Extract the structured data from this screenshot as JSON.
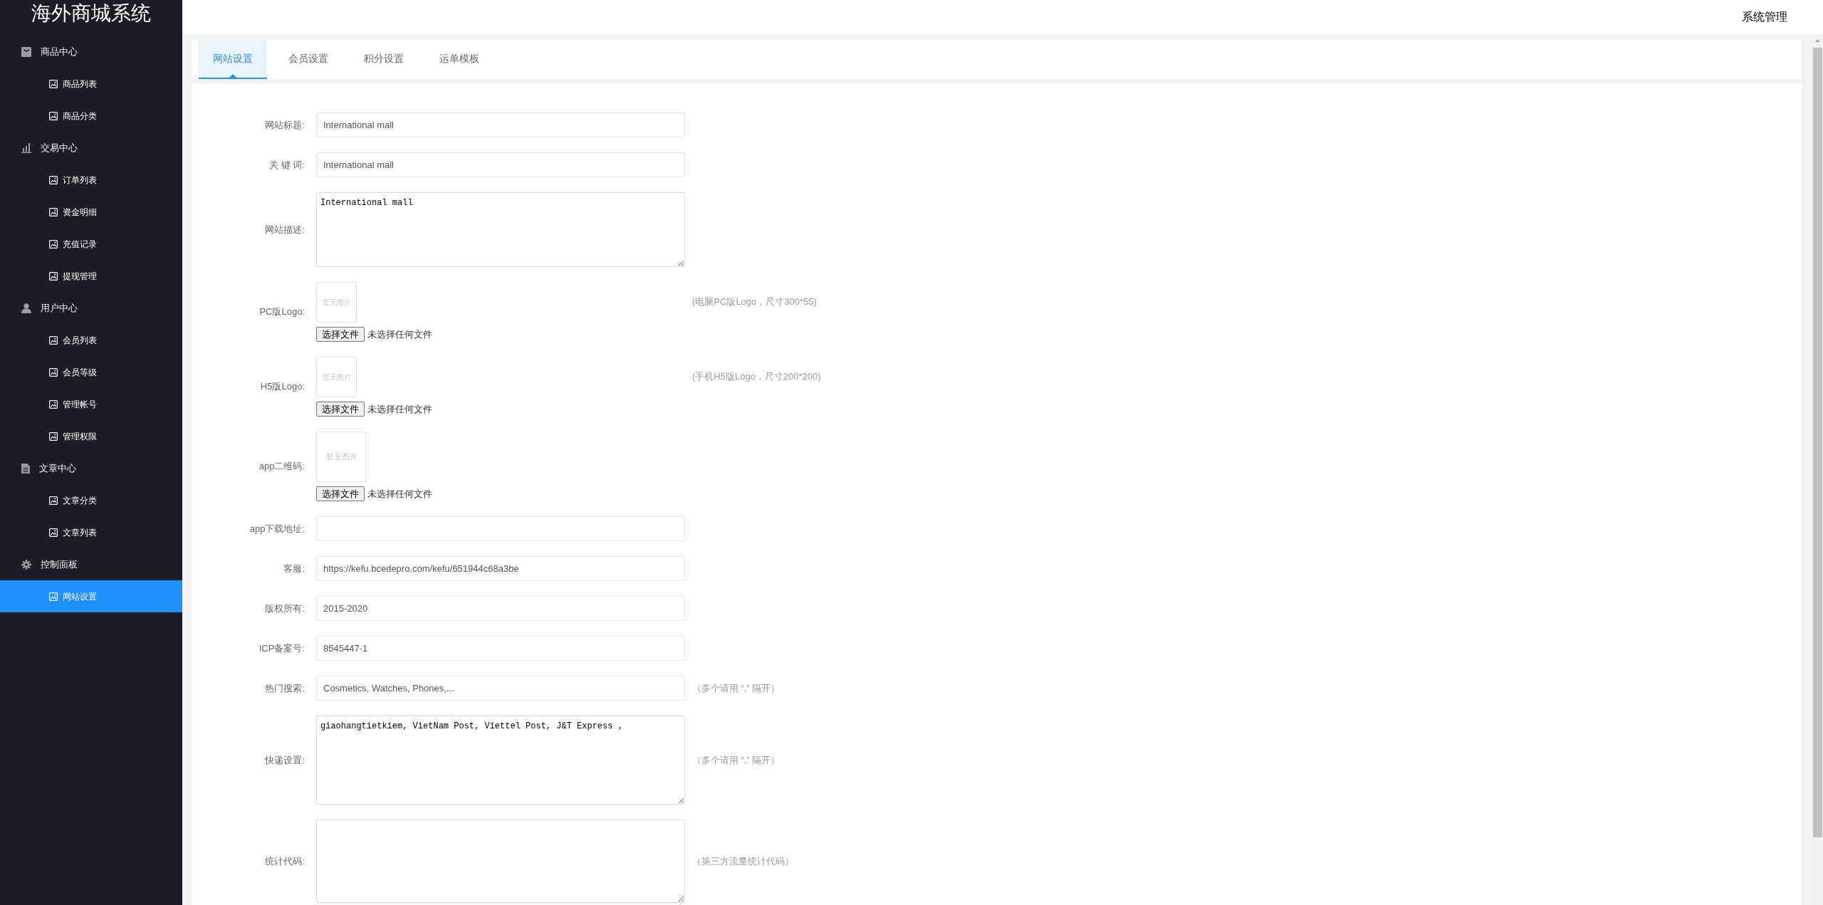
{
  "sidebar": {
    "title": "海外商城系统",
    "sections": [
      {
        "label": "商品中心",
        "children": [
          {
            "label": "商品列表",
            "selected": false
          },
          {
            "label": "商品分类",
            "selected": false
          }
        ]
      },
      {
        "label": "交易中心",
        "children": [
          {
            "label": "订单列表",
            "selected": false
          },
          {
            "label": "资金明细",
            "selected": false
          },
          {
            "label": "充值记录",
            "selected": false
          },
          {
            "label": "提现管理",
            "selected": false
          }
        ]
      },
      {
        "label": "用户中心",
        "children": [
          {
            "label": "会员列表",
            "selected": false
          },
          {
            "label": "会员等级",
            "selected": false
          },
          {
            "label": "管理帐号",
            "selected": false
          },
          {
            "label": "管理权限",
            "selected": false
          }
        ]
      },
      {
        "label": "文章中心",
        "children": [
          {
            "label": "文章分类",
            "selected": false
          },
          {
            "label": "文章列表",
            "selected": false
          }
        ]
      },
      {
        "label": "控制面板",
        "children": [
          {
            "label": "网站设置",
            "selected": true
          }
        ]
      }
    ]
  },
  "header": {
    "admin_label": "系统管理"
  },
  "tabs": [
    {
      "label": "网站设置",
      "selected": true
    },
    {
      "label": "会员设置",
      "selected": false
    },
    {
      "label": "积分设置",
      "selected": false
    },
    {
      "label": "运单模板",
      "selected": false
    }
  ],
  "form": {
    "fields": [
      {
        "kind": "text",
        "label": "网站标题:",
        "value": "International mall"
      },
      {
        "kind": "text",
        "label": "关 键 词:",
        "value": "International mall"
      },
      {
        "kind": "textarea",
        "label": "网站描述:",
        "value": "International mall"
      },
      {
        "kind": "logo_upload",
        "label": "PC版Logo:",
        "image_text": "暂无图片",
        "button": "选择文件",
        "file_status": "未选择任何文件",
        "hint": "(电脑PC版Logo，尺寸300*55)"
      },
      {
        "kind": "logo_upload",
        "label": "H5版Logo:",
        "image_text": "暂无图片",
        "button": "选择文件",
        "file_status": "未选择任何文件",
        "hint": "(手机H5版Logo，尺寸200*200)"
      },
      {
        "kind": "qr_upload",
        "label": "app二维码:",
        "image_text": "暂无图片",
        "button": "选择文件",
        "file_status": "未选择任何文件"
      },
      {
        "kind": "text",
        "label": "app下载地址:"
      },
      {
        "kind": "text",
        "label": "客服:",
        "value": "https://kefu.bcedepro.com/kefu/651944c68a3be"
      },
      {
        "kind": "text",
        "label": "版权所有:",
        "value": "2015-2020"
      },
      {
        "kind": "text",
        "label": "ICP备案号:",
        "value": "8545447-1"
      },
      {
        "kind": "text",
        "label": "热门搜索:",
        "value": "Cosmetics, Watches, Phones,...",
        "hint": "（多个请用 “,” 隔开）"
      },
      {
        "kind": "textarea",
        "label": "快递设置:",
        "value": "giaohangtietkiem, VietNam Post, Viettel Post, J&T Express ,",
        "hint": "（多个请用 “,” 隔开）"
      },
      {
        "kind": "textarea",
        "label": "统计代码:",
        "hint": "（第三方流量统计代码）"
      }
    ]
  }
}
